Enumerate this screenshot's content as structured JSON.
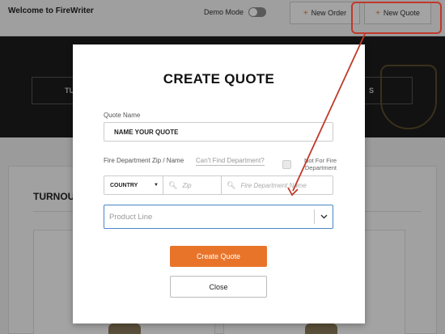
{
  "header": {
    "app_title": "Welcome to FireWriter",
    "demo_mode_label": "Demo Mode",
    "new_order_label": "New Order",
    "new_quote_label": "New Quote",
    "plus_glyph": "+"
  },
  "hero": {
    "tab_left_label": "TU",
    "tab_right_label": "S"
  },
  "content": {
    "section_title": "TURNOUT"
  },
  "modal": {
    "title": "CREATE QUOTE",
    "quote_name_label": "Quote Name",
    "quote_name_placeholder": "NAME YOUR QUOTE",
    "dept_label": "Fire Department Zip / Name",
    "cant_find_link": "Can't Find Department?",
    "not_for_fire_dept_label": "Not For Fire Department",
    "country_value": "COUNTRY",
    "zip_placeholder": "Zip",
    "dept_name_placeholder": "Fire Department Name",
    "product_line_placeholder": "Product Line",
    "create_button": "Create Quote",
    "close_button": "Close"
  },
  "colors": {
    "accent_orange": "#e8742a",
    "annotation_red": "#c0392b",
    "focus_blue": "#4a86c8"
  },
  "icons": {
    "search": "search-icon",
    "dropdown": "chevron-down-icon",
    "caret": "caret-down-icon"
  }
}
